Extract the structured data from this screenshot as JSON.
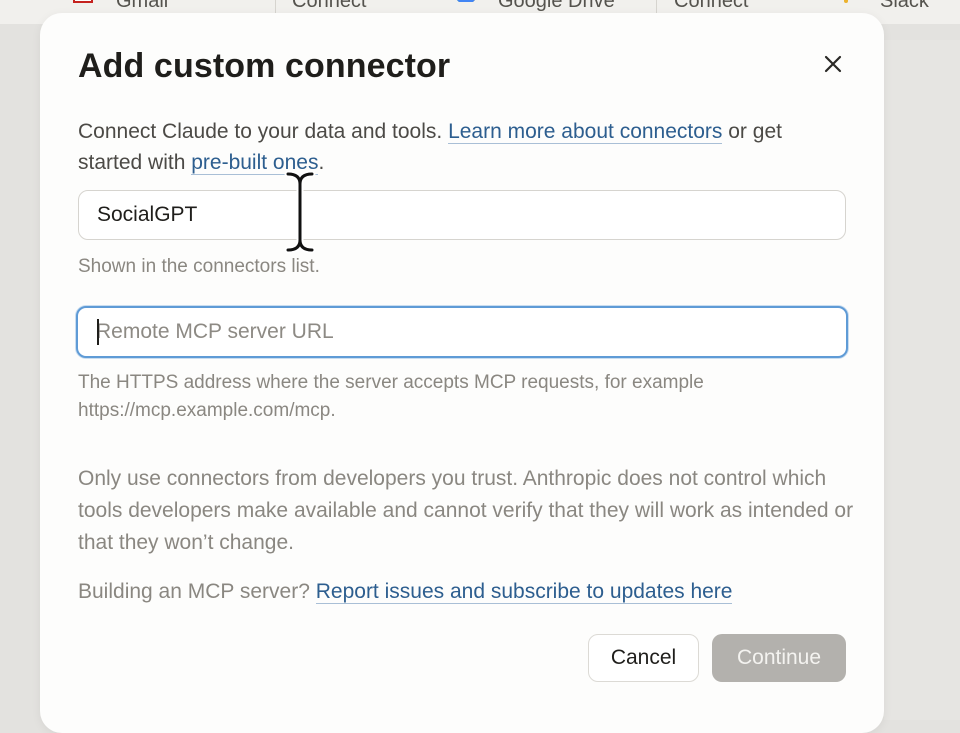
{
  "background": {
    "items": [
      {
        "label": "Gmail",
        "icon": "gmail-icon"
      },
      {
        "label": "Connect"
      },
      {
        "label": "Google Drive",
        "icon": "google-drive-icon"
      },
      {
        "label": "Connect"
      },
      {
        "label": "Slack",
        "icon": "slack-icon"
      }
    ]
  },
  "modal": {
    "title": "Add custom connector",
    "close_icon": "close-icon",
    "intro_text": "Connect Claude to your data and tools. ",
    "learn_more_link": "Learn more about connectors",
    "intro_or": " or get started with ",
    "prebuilt_link": "pre-built ones",
    "intro_end": ".",
    "name_input": {
      "value": "SocialGPT",
      "hint": "Shown in the connectors list."
    },
    "url_input": {
      "value": "",
      "placeholder": "Remote MCP server URL",
      "hint": "The HTTPS address where the server accepts MCP requests, for example https://mcp.example.com/mcp."
    },
    "warning": "Only use connectors from developers you trust. Anthropic does not control which tools developers make available and cannot verify that they will work as intended or that they won’t change.",
    "building_text": "Building an MCP server? ",
    "report_link": "Report issues and subscribe to updates here",
    "cancel_label": "Cancel",
    "continue_label": "Continue"
  },
  "colors": {
    "link": "#2d5e8f",
    "focus_border": "#5f9bd6",
    "continue_disabled": "#b3b1ad"
  }
}
